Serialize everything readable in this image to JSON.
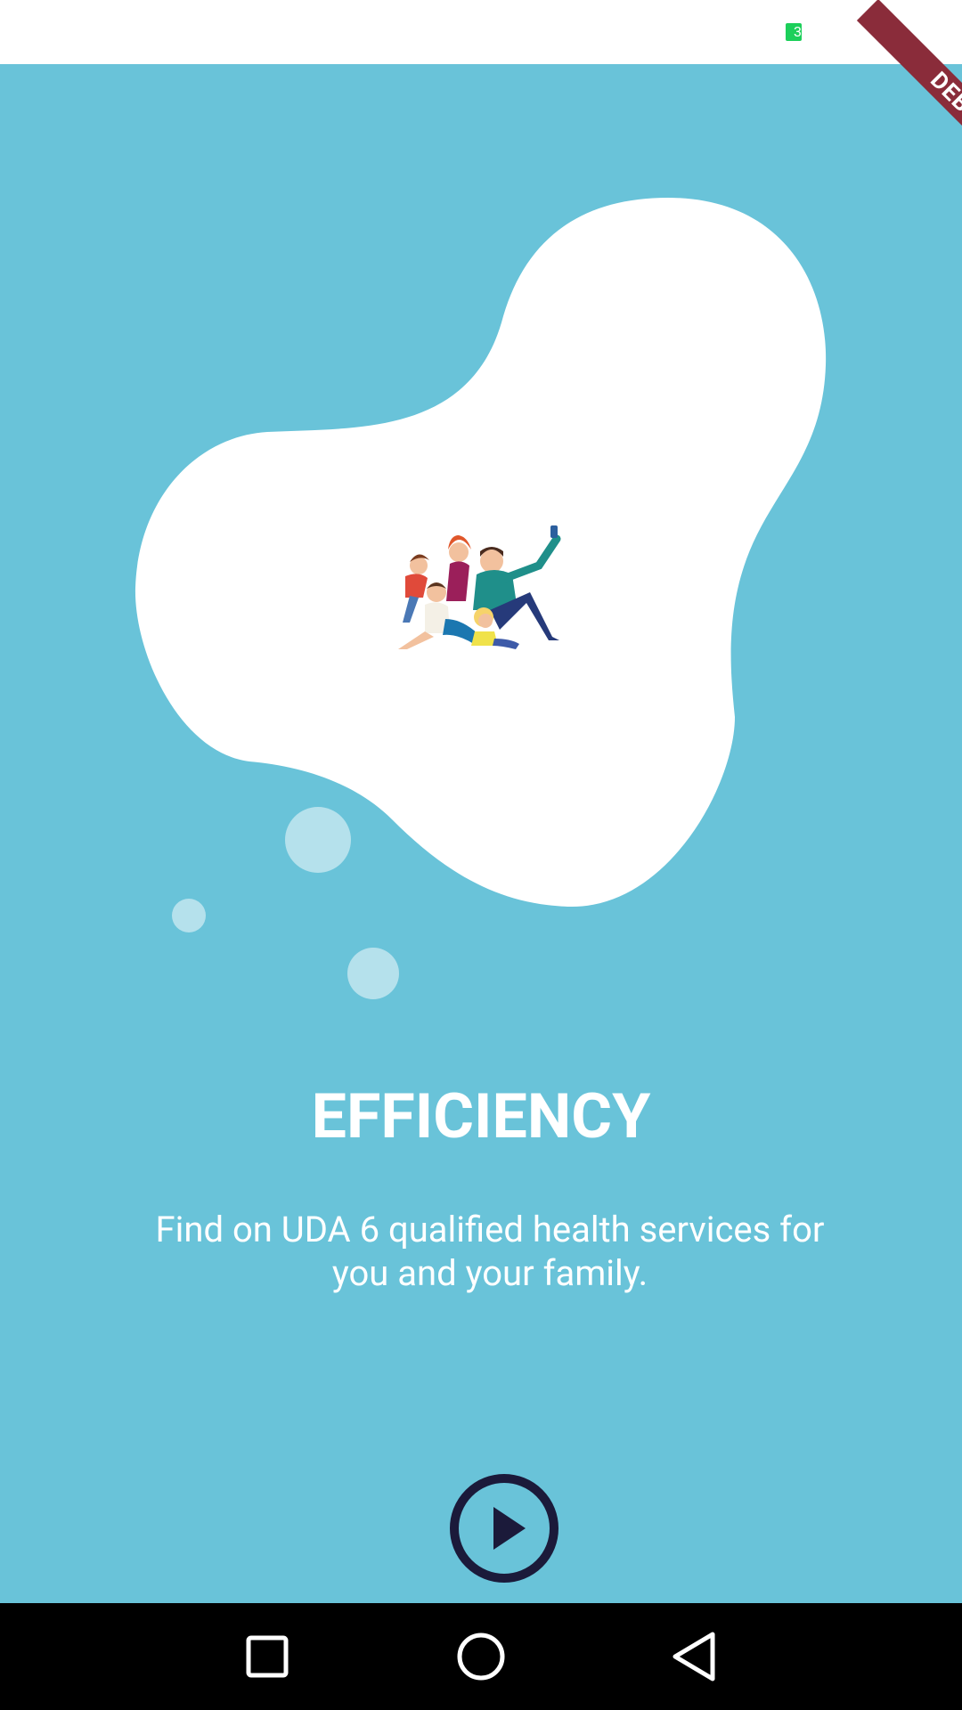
{
  "status_bar": {
    "battery_icon": "battery-icon",
    "battery_text": "3",
    "battery_color": "#1ccf5a"
  },
  "debug_banner": {
    "label": "DEBUG",
    "color": "#8a2c3a"
  },
  "onboarding": {
    "illustration": "family-selfie-illustration",
    "title": "EFFICIENCY",
    "description": "Find on UDA 6 qualified health services for you and your family.",
    "next_icon": "play-circle-icon"
  },
  "nav_bar": {
    "recents_icon": "square-icon",
    "home_icon": "circle-icon",
    "back_icon": "triangle-back-icon"
  },
  "colors": {
    "background": "#69c3d9",
    "blob": "#ffffff",
    "bubbles": "#b5e1ec",
    "play_button": "#1b1a3a",
    "text": "#ffffff"
  }
}
